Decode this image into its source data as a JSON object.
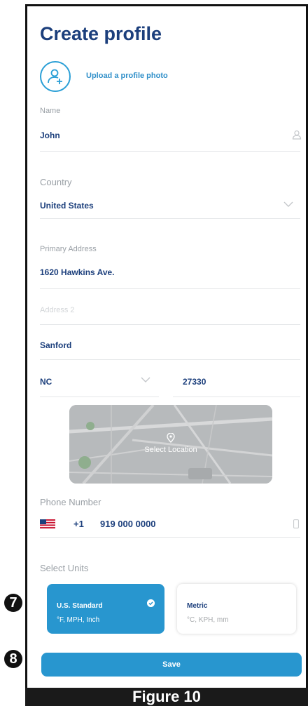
{
  "header": {
    "title": "Create profile"
  },
  "photo": {
    "upload_label": "Upload a profile photo",
    "icon": "add-user-icon"
  },
  "name": {
    "label": "Name",
    "value": "John",
    "icon": "user-icon"
  },
  "country": {
    "label": "Country",
    "value": "United States",
    "icon": "chevron-down-icon"
  },
  "address": {
    "primary_label": "Primary Address",
    "primary_value": "1620 Hawkins Ave.",
    "address2_placeholder": "Address 2",
    "city_value": "Sanford",
    "state_value": "NC",
    "zip_value": "27330"
  },
  "map": {
    "label": "Select Location",
    "pin_icon": "location-pin-icon"
  },
  "phone": {
    "label": "Phone Number",
    "country_code": "+1",
    "number": "919 000 0000",
    "flag_icon": "us-flag-icon",
    "device_icon": "phone-icon"
  },
  "units": {
    "label": "Select Units",
    "options": [
      {
        "name": "U.S. Standard",
        "desc": "°F, MPH, Inch",
        "selected": true
      },
      {
        "name": "Metric",
        "desc": "°C, KPH, mm",
        "selected": false
      }
    ]
  },
  "save": {
    "label": "Save"
  },
  "annotations": {
    "step_units": "7",
    "step_save": "8"
  },
  "caption": "Figure 10",
  "colors": {
    "accent": "#2896cf",
    "title": "#1c3f7c",
    "border": "#e4e6e8"
  }
}
